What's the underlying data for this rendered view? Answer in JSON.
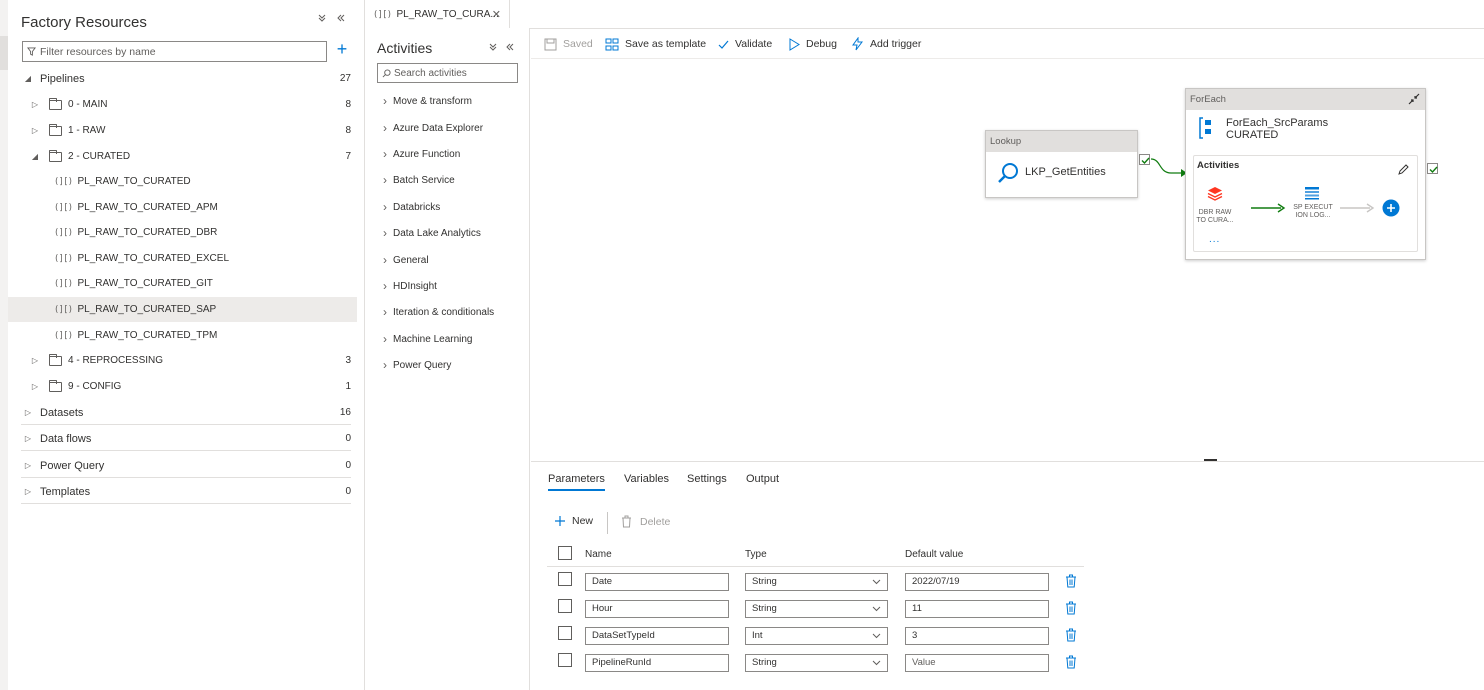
{
  "factory_resources": {
    "title": "Factory Resources",
    "filter_placeholder": "Filter resources by name",
    "tree": [
      {
        "label": "Pipelines",
        "count": "27",
        "level": 0,
        "type": "section",
        "expanded": true
      },
      {
        "label": "0 - MAIN",
        "count": "8",
        "level": 1,
        "type": "folder",
        "expanded": false
      },
      {
        "label": "1 - RAW",
        "count": "8",
        "level": 1,
        "type": "folder",
        "expanded": false
      },
      {
        "label": "2 - CURATED",
        "count": "7",
        "level": 1,
        "type": "folder",
        "expanded": true
      },
      {
        "label": "PL_RAW_TO_CURATED",
        "count": "",
        "level": 2,
        "type": "pipeline"
      },
      {
        "label": "PL_RAW_TO_CURATED_APM",
        "count": "",
        "level": 2,
        "type": "pipeline"
      },
      {
        "label": "PL_RAW_TO_CURATED_DBR",
        "count": "",
        "level": 2,
        "type": "pipeline"
      },
      {
        "label": "PL_RAW_TO_CURATED_EXCEL",
        "count": "",
        "level": 2,
        "type": "pipeline"
      },
      {
        "label": "PL_RAW_TO_CURATED_GIT",
        "count": "",
        "level": 2,
        "type": "pipeline"
      },
      {
        "label": "PL_RAW_TO_CURATED_SAP",
        "count": "",
        "level": 2,
        "type": "pipeline",
        "selected": true
      },
      {
        "label": "PL_RAW_TO_CURATED_TPM",
        "count": "",
        "level": 2,
        "type": "pipeline"
      },
      {
        "label": "4 - REPROCESSING",
        "count": "3",
        "level": 1,
        "type": "folder",
        "expanded": false
      },
      {
        "label": "9 - CONFIG",
        "count": "1",
        "level": 1,
        "type": "folder",
        "expanded": false
      },
      {
        "label": "Datasets",
        "count": "16",
        "level": 0,
        "type": "section",
        "expanded": false
      },
      {
        "label": "Data flows",
        "count": "0",
        "level": 0,
        "type": "section",
        "expanded": false
      },
      {
        "label": "Power Query",
        "count": "0",
        "level": 0,
        "type": "section",
        "expanded": false
      },
      {
        "label": "Templates",
        "count": "0",
        "level": 0,
        "type": "section",
        "expanded": false
      }
    ]
  },
  "tab": {
    "label": "PL_RAW_TO_CURA...",
    "close": "✕"
  },
  "activities": {
    "title": "Activities",
    "search_placeholder": "Search activities",
    "categories": [
      "Move & transform",
      "Azure Data Explorer",
      "Azure Function",
      "Batch Service",
      "Databricks",
      "Data Lake Analytics",
      "General",
      "HDInsight",
      "Iteration & conditionals",
      "Machine Learning",
      "Power Query"
    ]
  },
  "toolbar": {
    "saved": "Saved",
    "save_as_template": "Save as template",
    "validate": "Validate",
    "debug": "Debug",
    "add_trigger": "Add trigger"
  },
  "canvas": {
    "lookup": {
      "type": "Lookup",
      "name": "LKP_GetEntities"
    },
    "foreach": {
      "type": "ForEach",
      "name_line1": "ForEach_SrcParams",
      "name_line2": "CURATED",
      "activities_label": "Activities",
      "inner1_line1": "DBR RAW",
      "inner1_line2": "TO CURA...",
      "inner2_line1": "SP EXECUT",
      "inner2_line2": "ION LOG...",
      "more": "..."
    }
  },
  "bottom": {
    "tabs": [
      "Parameters",
      "Variables",
      "Settings",
      "Output"
    ],
    "active_tab": "Parameters",
    "new_label": "New",
    "delete_label": "Delete",
    "columns": {
      "name": "Name",
      "type": "Type",
      "default": "Default value"
    },
    "rows": [
      {
        "name": "Date",
        "type": "String",
        "default": "2022/07/19",
        "default_is_placeholder": false
      },
      {
        "name": "Hour",
        "type": "String",
        "default": "11",
        "default_is_placeholder": false
      },
      {
        "name": "DataSetTypeId",
        "type": "Int",
        "default": "3",
        "default_is_placeholder": false
      },
      {
        "name": "PipelineRunId",
        "type": "String",
        "default": "Value",
        "default_is_placeholder": true
      }
    ]
  },
  "colors": {
    "accent": "#0078d4",
    "success": "#107c10",
    "header_gray": "#e1dfdd",
    "selected_row": "#edebe9"
  }
}
